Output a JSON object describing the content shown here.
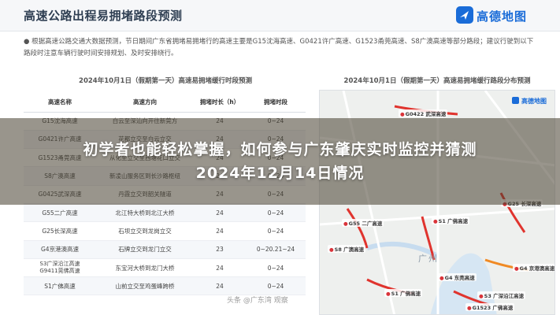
{
  "header": {
    "title": "高速公路出程易拥堵路段预测",
    "logo_text": "高德地图"
  },
  "intro": {
    "text": "● 根据高速公路交通大数据预测，节日期间广东省拥堵易拥堵行的高速主要是G15沈海高速、G0421许广高速、G1523甬莞高速、S8广澳高速等部分路段；建议行驶到以下路段时注意车辆行驶时间安排规划、及时安排绕行。"
  },
  "table": {
    "title": "2024年10月1日（假期第一天）高速易拥堵缓行时段预测",
    "headers": [
      "高速名称",
      "高速方向",
      "拥堵时长（h）",
      "拥堵时段"
    ],
    "rows": [
      [
        "G15沈海高速",
        "白云至深汕向开往新莞方",
        "24",
        "0~24"
      ],
      [
        "G0421许广高速",
        "花都立交至白云立交",
        "24",
        "0~24"
      ],
      [
        "G1523甬莞高速",
        "从化至立交至西塘花口立交",
        "24",
        "0~24"
      ],
      [
        "S8广澳高速",
        "新凌山服务区到长沙路枢纽",
        "24",
        "0~24"
      ],
      [
        "G0425武深高速",
        "丹霞立交到韶关隧道",
        "24",
        "0~24"
      ],
      [
        "G55二广高速",
        "北江特大桥到北江大桥",
        "24",
        "0~24"
      ],
      [
        "G25长深高速",
        "石坝立交到龙岗立交",
        "24",
        "0~24"
      ],
      [
        "G4京港澳高速",
        "石牌立交到龙门立交",
        "23",
        "0~20.21~24"
      ],
      [
        "S3广深沿江高速\nG9411莞佛高速",
        "东宝河大桥到龙门大桥",
        "24",
        "0~24"
      ],
      [
        "S1广佛高速",
        "山前立交至鸡蛋峰跨桥",
        "24",
        "0~24"
      ]
    ]
  },
  "map": {
    "title": "2024年10月1日（假期第一天）高速易拥堵缓行路段分布预测",
    "logo_text": "高德地图",
    "city_label": "广州",
    "road_labels": [
      "G0422 武深高速",
      "G55 二广高速",
      "S1 广佛高速",
      "G25 长深高速",
      "G4 京港澳高速",
      "S3 广深沿江高速",
      "S8 广澳高速",
      "S1 广佛高速",
      "G4 东莞高速",
      "G1523 广佛高速"
    ]
  },
  "banner": {
    "line1": "初学者也能轻松掌握，如何参与广东肇庆实时监控并猜测",
    "line2": "2024年12月14日情况"
  },
  "watermark": {
    "text": "头条 @广东湾 观察"
  }
}
